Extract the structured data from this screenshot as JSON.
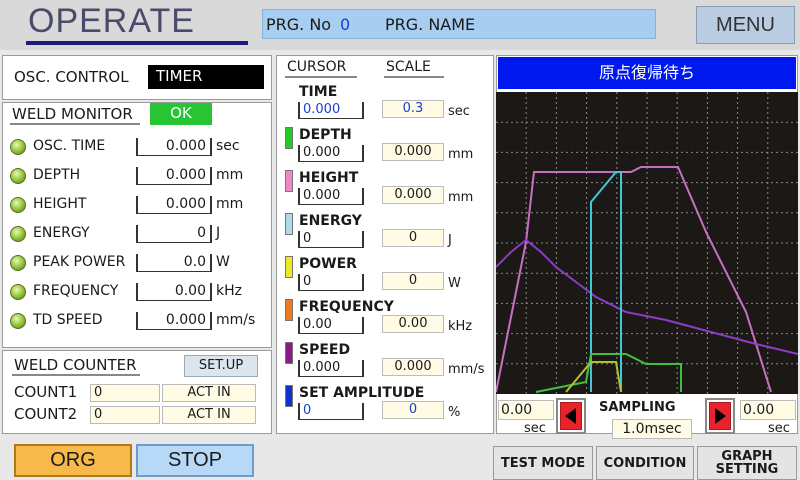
{
  "header": {
    "title": "OPERATE",
    "prg_no_label": "PRG. No",
    "prg_no_value": "0",
    "prg_name_label": "PRG. NAME",
    "menu_label": "MENU"
  },
  "osc_control": {
    "label": "OSC. CONTROL",
    "value": "TIMER"
  },
  "weld_monitor": {
    "title": "WELD MONITOR",
    "status": "OK",
    "status_color": "#27c433",
    "items": [
      {
        "label": "OSC. TIME",
        "value": "0.000",
        "unit": "sec"
      },
      {
        "label": "DEPTH",
        "value": "0.000",
        "unit": "mm"
      },
      {
        "label": "HEIGHT",
        "value": "0.000",
        "unit": "mm"
      },
      {
        "label": "ENERGY",
        "value": "0",
        "unit": "J"
      },
      {
        "label": "PEAK POWER",
        "value": "0.0",
        "unit": "W"
      },
      {
        "label": "FREQUENCY",
        "value": "0.00",
        "unit": "kHz"
      },
      {
        "label": "TD SPEED",
        "value": "0.000",
        "unit": "mm/s"
      }
    ]
  },
  "weld_counter": {
    "title": "WELD COUNTER",
    "setup_label": "SET.UP",
    "rows": [
      {
        "label": "COUNT1",
        "value": "0",
        "action": "ACT IN"
      },
      {
        "label": "COUNT2",
        "value": "0",
        "action": "ACT IN"
      }
    ]
  },
  "cursor_panel": {
    "cursor_header": "CURSOR",
    "scale_header": "SCALE",
    "params": [
      {
        "name": "TIME",
        "cursor": "0.000",
        "scale": "0.3",
        "unit": "sec",
        "color": "",
        "highlight": true
      },
      {
        "name": "DEPTH",
        "cursor": "0.000",
        "scale": "0.000",
        "unit": "mm",
        "color": "#22cc22",
        "highlight": false
      },
      {
        "name": "HEIGHT",
        "cursor": "0.000",
        "scale": "0.000",
        "unit": "mm",
        "color": "#ee88c8",
        "highlight": false
      },
      {
        "name": "ENERGY",
        "cursor": "0",
        "scale": "0",
        "unit": "J",
        "color": "#aadbe8",
        "highlight": false
      },
      {
        "name": "POWER",
        "cursor": "0",
        "scale": "0",
        "unit": "W",
        "color": "#f0e820",
        "highlight": false
      },
      {
        "name": "FREQUENCY",
        "cursor": "0.00",
        "scale": "0.00",
        "unit": "kHz",
        "color": "#f07820",
        "highlight": false
      },
      {
        "name": "SPEED",
        "cursor": "0.000",
        "scale": "0.000",
        "unit": "mm/s",
        "color": "#8a1a8a",
        "highlight": false
      },
      {
        "name": "SET AMPLITUDE",
        "cursor": "0",
        "scale": "0",
        "unit": "%",
        "color": "#1030d0",
        "highlight": true
      }
    ]
  },
  "graph": {
    "title": "原点復帰待ち",
    "title_bg": "#0018f0",
    "left_value": "0.00",
    "left_unit": "sec",
    "right_value": "0.00",
    "right_unit": "sec",
    "sampling_label": "SAMPLING",
    "sampling_value": "1.0msec"
  },
  "buttons": {
    "org": "ORG",
    "stop": "STOP",
    "test_mode": "TEST MODE",
    "condition": "CONDITION",
    "graph_setting_line1": "GRAPH",
    "graph_setting_line2": "SETTING"
  }
}
